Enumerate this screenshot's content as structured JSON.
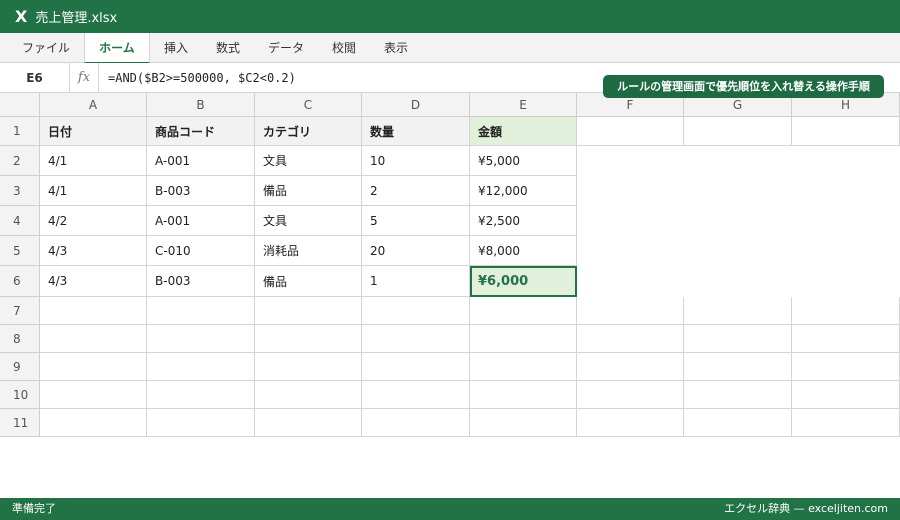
{
  "app": {
    "logo": "X",
    "title": "売上管理.xlsx"
  },
  "ribbon": {
    "tabs": [
      "ファイル",
      "ホーム",
      "挿入",
      "数式",
      "データ",
      "校閲",
      "表示"
    ],
    "active": "ホーム"
  },
  "formula_bar": {
    "name_box": "E6",
    "fx": "fx",
    "formula": "=AND($B2>=500000, $C2<0.2)"
  },
  "callout": "ルールの管理画面で優先順位を入れ替える操作手順",
  "sheet": {
    "columns": [
      "A",
      "B",
      "C",
      "D",
      "E",
      "F",
      "G",
      "H"
    ],
    "rows": [
      "1",
      "2",
      "3",
      "4",
      "5",
      "6",
      "7",
      "8",
      "9",
      "10",
      "11"
    ],
    "header_row": [
      "日付",
      "商品コード",
      "カテゴリ",
      "数量",
      "金額"
    ],
    "data": [
      [
        "4/1",
        "A-001",
        "文具",
        "10",
        "¥5,000"
      ],
      [
        "4/1",
        "B-003",
        "備品",
        "2",
        "¥12,000"
      ],
      [
        "4/2",
        "A-001",
        "文具",
        "5",
        "¥2,500"
      ],
      [
        "4/3",
        "C-010",
        "消耗品",
        "20",
        "¥8,000"
      ],
      [
        "4/3",
        "B-003",
        "備品",
        "1",
        "¥6,000"
      ]
    ],
    "active_cell": "E6"
  },
  "status": {
    "left": "準備完了",
    "right": "エクセル辞典 — exceljiten.com"
  },
  "colors": {
    "accent": "#217346",
    "highlight": "#e2efda",
    "callout": "#1e6b43"
  }
}
